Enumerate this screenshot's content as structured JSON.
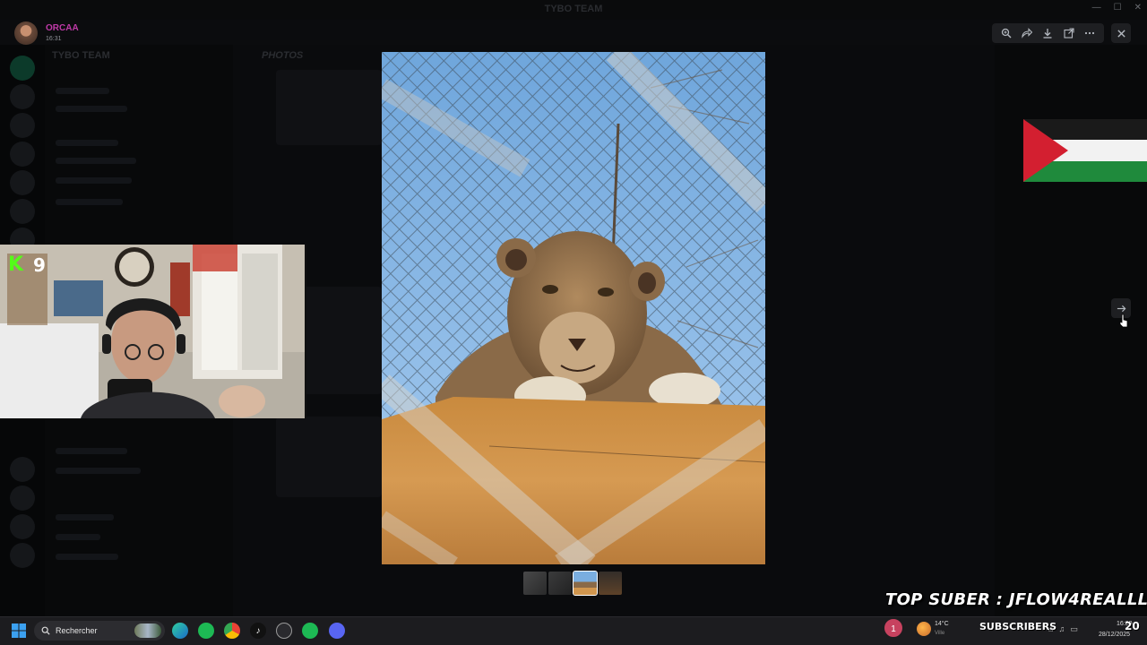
{
  "window": {
    "title": "TYBO TEAM"
  },
  "background": {
    "server_name": "TYBO TEAM",
    "chat_title": "PHOTOS"
  },
  "viewer": {
    "user_name": "ORCAA",
    "time": "16:31",
    "tools": [
      {
        "name": "zoom-icon"
      },
      {
        "name": "forward-icon"
      },
      {
        "name": "download-icon"
      },
      {
        "name": "open-external-icon"
      },
      {
        "name": "more-icon"
      }
    ],
    "thumb_count": 4,
    "active_thumb": 3
  },
  "stream_overlay": {
    "kick_viewers": "9",
    "top_suber": "TOP SUBER : JFLOW4REALLL",
    "subscribers_label": "SUBSCRIBERS",
    "subscribers_count": "20"
  },
  "taskbar": {
    "search_placeholder": "Rechercher",
    "apps": [
      "edge-icon",
      "spotify-icon",
      "chrome-icon",
      "tiktok-icon",
      "obs-icon",
      "spotify-icon",
      "discord-icon"
    ],
    "notification_count": "1",
    "weather_temp": "14°C",
    "weather_desc": "Ville",
    "time": "16:20",
    "date": "28/12/2025"
  },
  "colors": {
    "accent_user": "#c03aa8",
    "kick_green": "#53fc18",
    "notif": "#c7425f"
  }
}
